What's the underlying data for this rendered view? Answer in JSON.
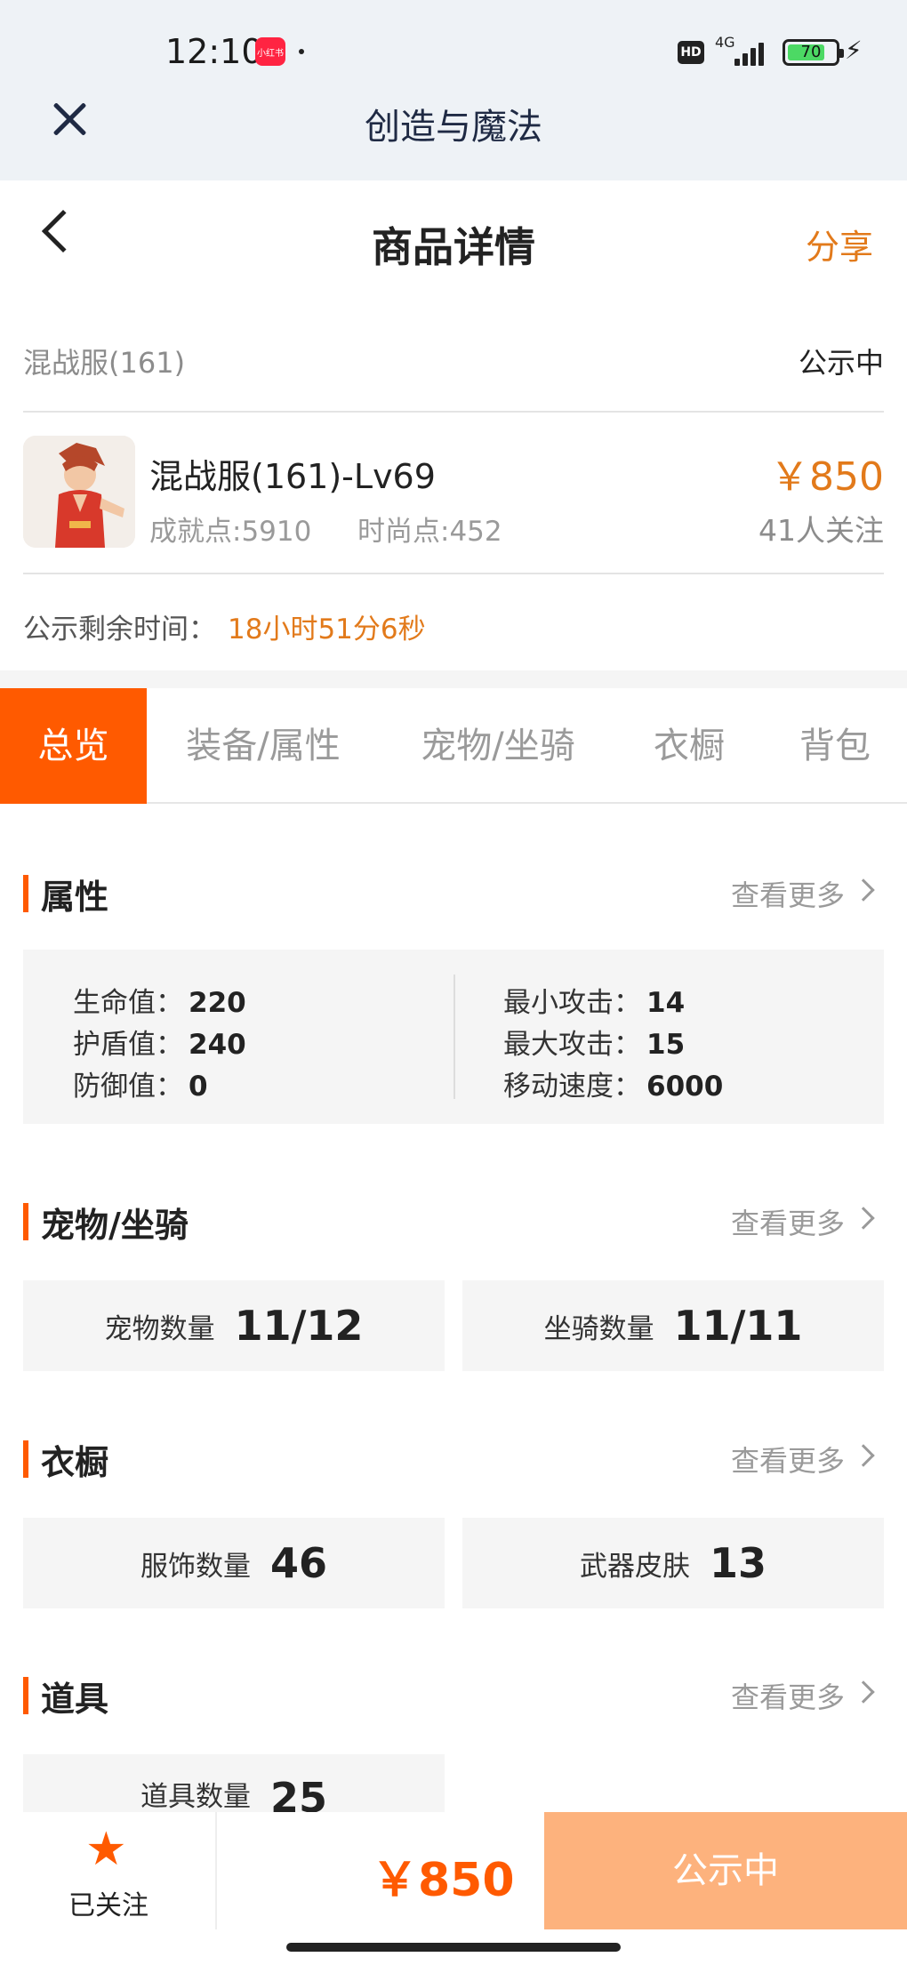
{
  "status_bar": {
    "time": "12:10",
    "app_badge": "小红书",
    "hd": "HD",
    "network": "4G",
    "battery": "70"
  },
  "app_bar": {
    "title": "创造与魔法"
  },
  "header": {
    "title": "商品详情",
    "share": "分享"
  },
  "listing": {
    "server": "混战服(161)",
    "status": "公示中",
    "name": "混战服(161)-Lv69",
    "achievement": "成就点:5910",
    "fashion": "时尚点:452",
    "price": "￥850",
    "followers": "41人关注",
    "remaining_label": "公示剩余时间：",
    "remaining_value": "18小时51分6秒"
  },
  "tabs": [
    {
      "label": "总览",
      "active": true
    },
    {
      "label": "装备/属性"
    },
    {
      "label": "宠物/坐骑"
    },
    {
      "label": "衣橱"
    },
    {
      "label": "背包"
    }
  ],
  "see_more": "查看更多",
  "attributes": {
    "title": "属性",
    "left": [
      {
        "label": "生命值：",
        "value": "220"
      },
      {
        "label": "护盾值：",
        "value": "240"
      },
      {
        "label": "防御值：",
        "value": "0"
      }
    ],
    "right": [
      {
        "label": "最小攻击：",
        "value": "14"
      },
      {
        "label": "最大攻击：",
        "value": "15"
      },
      {
        "label": "移动速度：",
        "value": "6000"
      }
    ]
  },
  "pets": {
    "title": "宠物/坐骑",
    "items": [
      {
        "label": "宠物数量",
        "value": "11/12"
      },
      {
        "label": "坐骑数量",
        "value": "11/11"
      }
    ]
  },
  "wardrobe": {
    "title": "衣橱",
    "items": [
      {
        "label": "服饰数量",
        "value": "46"
      },
      {
        "label": "武器皮肤",
        "value": "13"
      }
    ]
  },
  "props": {
    "title": "道具",
    "items": [
      {
        "label": "道具数量",
        "value": "25"
      }
    ]
  },
  "bottom_bar": {
    "follow_label": "已关注",
    "price": "￥850",
    "buy_label": "公示中"
  },
  "colors": {
    "accent": "#ff5a00",
    "price": "#e27a1b",
    "button_disabled": "#fdb27d"
  }
}
